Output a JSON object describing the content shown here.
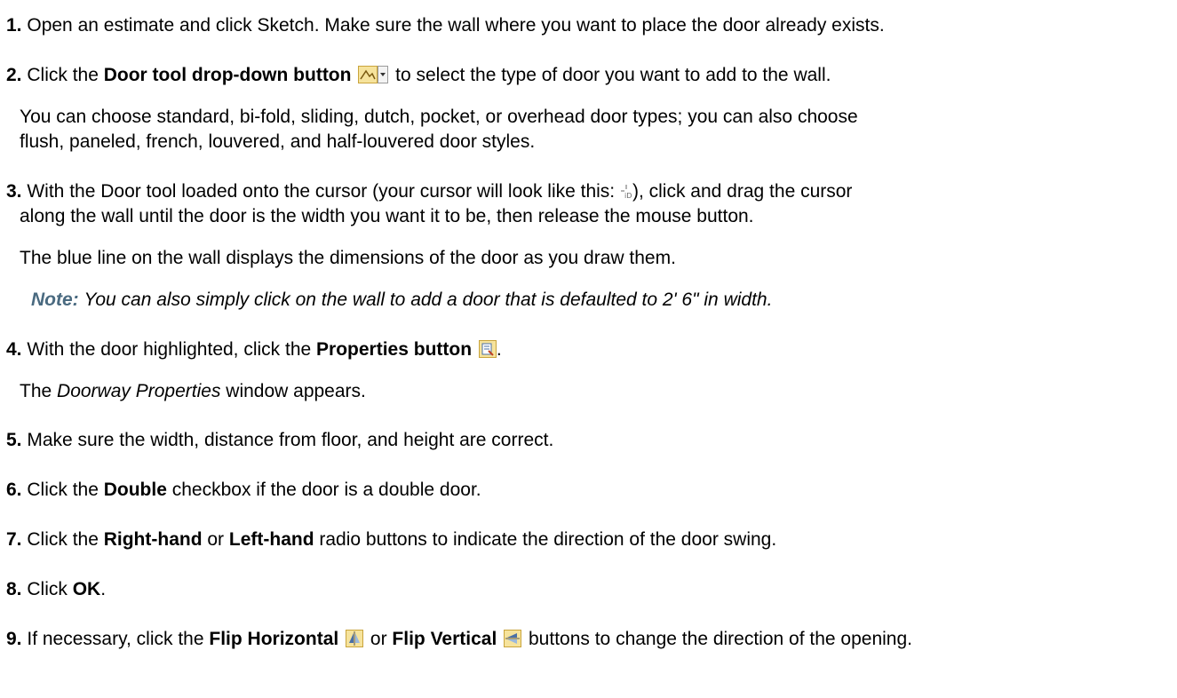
{
  "step1": {
    "num": "1.",
    "text": "Open an estimate and click Sketch. Make sure the wall where you want to place the door already exists."
  },
  "step2": {
    "num": "2.",
    "pre": "Click the ",
    "bold": "Door tool drop-down button",
    "icon": "door-tool-dropdown-icon",
    "post": "to select the type of door you want to add to the wall.",
    "detail_line1": "You can choose standard, bi-fold, sliding, dutch, pocket, or overhead door types; you can also choose",
    "detail_line2": "flush, paneled, french, louvered, and half-louvered door styles."
  },
  "step3": {
    "num": "3.",
    "pre": "With the Door tool loaded onto the cursor (your cursor will look like this: ",
    "icon": "door-cursor-icon",
    "post": "), click and drag the cursor",
    "line2": "along the wall until the door is the width you want it to be, then release the mouse button.",
    "detail": "The blue line on the wall displays the dimensions of the door as you draw them.",
    "note_label": "Note:",
    "note_text": "You can also simply click on the wall to add a door that is defaulted to 2' 6\" in width."
  },
  "step4": {
    "num": "4.",
    "pre": "With the door highlighted, click the ",
    "bold": "Properties button",
    "icon": "properties-icon",
    "post": ".",
    "detail_italic": "Doorway Properties",
    "detail_pre": "The ",
    "detail_post": " window appears."
  },
  "step5": {
    "num": "5.",
    "text": "Make sure the width, distance from floor, and height are correct."
  },
  "step6": {
    "num": "6.",
    "pre": "Click the ",
    "bold": "Double",
    "post": " checkbox if the door is a double door."
  },
  "step7": {
    "num": "7.",
    "pre": "Click the ",
    "bold1": "Right-hand",
    "mid": " or ",
    "bold2": "Left-hand",
    "post": " radio buttons to indicate the direction of the door swing."
  },
  "step8": {
    "num": "8.",
    "pre": "Click ",
    "bold": "OK",
    "post": "."
  },
  "step9": {
    "num": "9.",
    "pre": "If necessary, click the ",
    "bold1": "Flip Horizontal",
    "icon1": "flip-horizontal-icon",
    "mid": "or ",
    "bold2": "Flip Vertical",
    "icon2": "flip-vertical-icon",
    "post": "buttons to change the direction of the opening."
  },
  "colors": {
    "note_label": "#4a6a80",
    "icon_bg": "#f6e39c",
    "icon_border": "#c9a43c"
  }
}
